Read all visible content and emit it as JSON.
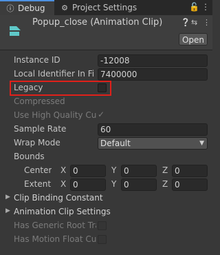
{
  "tabs": {
    "debug": {
      "label": "Debug",
      "icon": "info-icon"
    },
    "project_settings": {
      "label": "Project Settings",
      "icon": "gear-icon"
    },
    "lock_icon": "lock-icon",
    "menu_icon": "kebab-menu-icon"
  },
  "header": {
    "title": "Popup_close (Animation Clip)",
    "open_label": "Open",
    "icons": [
      "help-icon",
      "presets-icon",
      "more-icon"
    ]
  },
  "fields": {
    "instance_id": {
      "label": "Instance ID",
      "value": "-12008"
    },
    "local_identifier": {
      "label": "Local Identifier In File",
      "value": "7400000"
    },
    "legacy": {
      "label": "Legacy",
      "checked": false
    },
    "compressed": {
      "label": "Compressed"
    },
    "use_high_quality_curve": {
      "label": "Use High Quality Cur",
      "checked": true
    },
    "sample_rate": {
      "label": "Sample Rate",
      "value": "60"
    },
    "wrap_mode": {
      "label": "Wrap Mode",
      "value": "Default"
    },
    "bounds": {
      "label": "Bounds",
      "center": {
        "label": "Center",
        "x_label": "X",
        "x": "0",
        "y_label": "Y",
        "y": "0",
        "z_label": "Z",
        "z": "0"
      },
      "extent": {
        "label": "Extent",
        "x_label": "X",
        "x": "0",
        "y_label": "Y",
        "y": "0",
        "z_label": "Z",
        "z": "0"
      }
    },
    "clip_binding_constant": {
      "label": "Clip Binding Constant"
    },
    "animation_clip_settings": {
      "label": "Animation Clip Settings"
    },
    "has_generic_root": {
      "label": "Has Generic Root Tra",
      "checked": false
    },
    "has_motion_float": {
      "label": "Has Motion Float Cur",
      "checked": false
    }
  },
  "colors": {
    "highlight": "#e0201a",
    "accent": "#4d90e0",
    "asset_icon": "#5fc8c8"
  }
}
